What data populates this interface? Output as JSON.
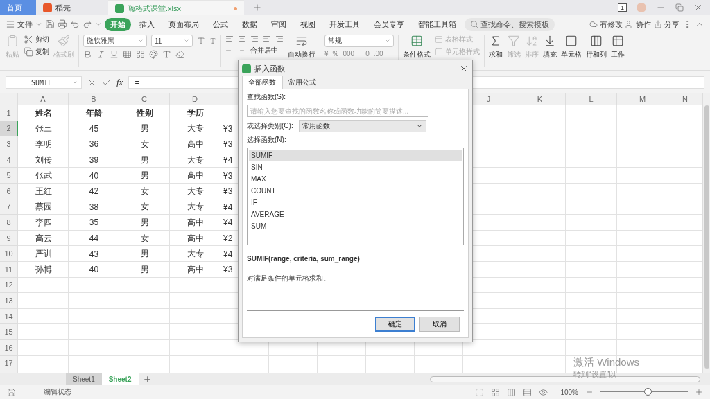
{
  "tabs": [
    {
      "label": "首页",
      "kind": "home",
      "selected": false
    },
    {
      "label": "稻壳",
      "kind": "docer",
      "selected": false
    },
    {
      "label": "嗨格式课堂.xlsx",
      "kind": "file",
      "selected": true,
      "unsaved": true
    }
  ],
  "window_badge": "1",
  "menu": {
    "file": "文件",
    "items": [
      {
        "label": "开始",
        "selected": true
      },
      {
        "label": "插入",
        "selected": false
      },
      {
        "label": "页面布局",
        "selected": false
      },
      {
        "label": "公式",
        "selected": false
      },
      {
        "label": "数据",
        "selected": false
      },
      {
        "label": "审阅",
        "selected": false
      },
      {
        "label": "视图",
        "selected": false
      },
      {
        "label": "开发工具",
        "selected": false
      },
      {
        "label": "会员专享",
        "selected": false
      },
      {
        "label": "智能工具箱",
        "selected": false
      }
    ],
    "search_placeholder": "查找命令、搜索模板",
    "actions": [
      "有修改",
      "协作",
      "分享"
    ]
  },
  "ribbon": {
    "paste": {
      "label": "粘贴",
      "disabled": true
    },
    "cut": "剪切",
    "copy": "复制",
    "format_painter": {
      "label": "格式刷",
      "disabled": true
    },
    "font": "微软雅黑",
    "font_size": "11",
    "merge": "合并居中",
    "wrap": "自动换行",
    "number_format": "常规",
    "number_buttons": [
      "¥",
      "%",
      "000",
      "←0",
      ".00"
    ],
    "conditional": "条件格式",
    "table_style": {
      "label": "表格样式",
      "disabled": true
    },
    "cell_style": {
      "label": "单元格样式",
      "disabled": true
    },
    "tools": [
      {
        "label": "求和",
        "disabled": false
      },
      {
        "label": "筛选",
        "disabled": true
      },
      {
        "label": "排序",
        "disabled": true
      },
      {
        "label": "填充",
        "disabled": false
      },
      {
        "label": "单元格",
        "disabled": false
      },
      {
        "label": "行和列",
        "disabled": false
      },
      {
        "label": "工作",
        "disabled": false
      }
    ]
  },
  "formula_bar": {
    "name_box": "SUMIF",
    "fx_label": "fx",
    "formula": "="
  },
  "sheet": {
    "columns": [
      "A",
      "B",
      "C",
      "D",
      "J",
      "K",
      "L",
      "M",
      "N"
    ],
    "rows": [
      {
        "num": "1",
        "selected": false,
        "header": true,
        "cells": [
          "姓名",
          "年龄",
          "性别",
          "学历"
        ]
      },
      {
        "num": "2",
        "selected": true,
        "cells": [
          "张三",
          "45",
          "男",
          "大专",
          "¥3"
        ]
      },
      {
        "num": "3",
        "selected": false,
        "cells": [
          "李明",
          "36",
          "女",
          "高中",
          "¥3"
        ]
      },
      {
        "num": "4",
        "selected": false,
        "cells": [
          "刘传",
          "39",
          "男",
          "大专",
          "¥4"
        ]
      },
      {
        "num": "5",
        "selected": false,
        "cells": [
          "张武",
          "40",
          "男",
          "高中",
          "¥3"
        ]
      },
      {
        "num": "6",
        "selected": false,
        "cells": [
          "王红",
          "42",
          "女",
          "大专",
          "¥3"
        ]
      },
      {
        "num": "7",
        "selected": false,
        "cells": [
          "蔡园",
          "38",
          "女",
          "大专",
          "¥4"
        ]
      },
      {
        "num": "8",
        "selected": false,
        "cells": [
          "李四",
          "35",
          "男",
          "高中",
          "¥4"
        ]
      },
      {
        "num": "9",
        "selected": false,
        "cells": [
          "高云",
          "44",
          "女",
          "高中",
          "¥2"
        ]
      },
      {
        "num": "10",
        "selected": false,
        "cells": [
          "严训",
          "43",
          "男",
          "大专",
          "¥4"
        ]
      },
      {
        "num": "11",
        "selected": false,
        "cells": [
          "孙博",
          "40",
          "男",
          "高中",
          "¥3"
        ]
      },
      {
        "num": "12",
        "selected": false
      },
      {
        "num": "13",
        "selected": false
      },
      {
        "num": "14",
        "selected": false
      },
      {
        "num": "15",
        "selected": false
      },
      {
        "num": "16",
        "selected": false
      },
      {
        "num": "17",
        "selected": false
      }
    ]
  },
  "sheet_tabs": [
    {
      "label": "Sheet1",
      "selected": false
    },
    {
      "label": "Sheet2",
      "selected": true
    }
  ],
  "status_bar": {
    "mode": "编辑状态",
    "zoom": "100%",
    "zoom_level": {
      "level": 0.54
    }
  },
  "activation": [
    "激活 Windows",
    "转到“设置”以"
  ],
  "dialog": {
    "title": "插入函数",
    "tabs": [
      {
        "label": "全部函数",
        "selected": true
      },
      {
        "label": "常用公式",
        "selected": false
      }
    ],
    "search_label": "查找函数(S):",
    "search_placeholder": "请输入您要查找的函数名称或函数功能的简要描述...",
    "category_label": "或选择类别(C):",
    "category": "常用函数",
    "list_label": "选择函数(N):",
    "functions": [
      {
        "name": "SUMIF",
        "selected": true
      },
      {
        "name": "SIN",
        "selected": false
      },
      {
        "name": "MAX",
        "selected": false
      },
      {
        "name": "COUNT",
        "selected": false
      },
      {
        "name": "IF",
        "selected": false
      },
      {
        "name": "AVERAGE",
        "selected": false
      },
      {
        "name": "SUM",
        "selected": false
      }
    ],
    "signature": "SUMIF(range, criteria, sum_range)",
    "description": "对满足条件的单元格求和。",
    "buttons": [
      {
        "label": "确定",
        "default": true
      },
      {
        "label": "取消",
        "default": false
      }
    ]
  }
}
